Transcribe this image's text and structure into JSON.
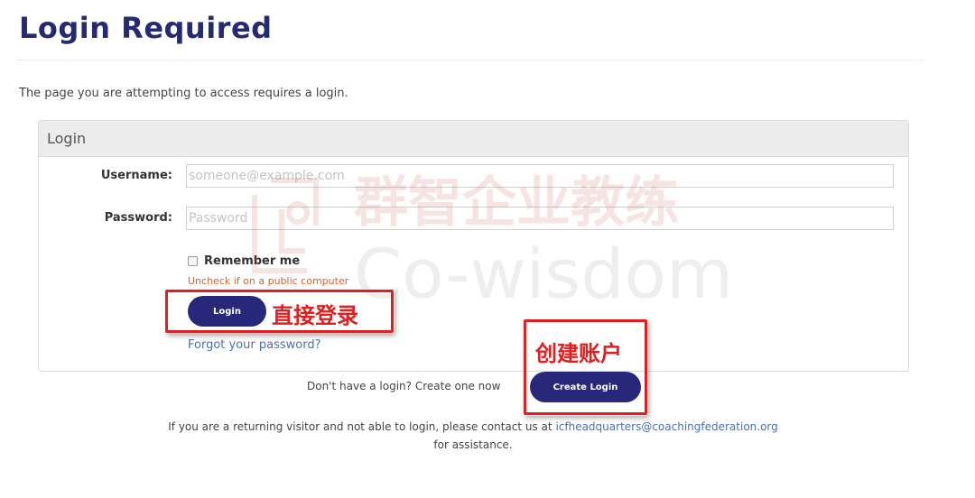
{
  "page": {
    "title": "Login Required",
    "intro": "The page you are attempting to access requires a login."
  },
  "login_panel": {
    "heading": "Login",
    "username_label": "Username:",
    "username_placeholder": "someone@example.com",
    "username_value": "",
    "password_label": "Password:",
    "password_placeholder": "Password",
    "password_value": "",
    "remember_label": "Remember me",
    "remember_checked": false,
    "remember_hint": "Uncheck if on a public computer",
    "login_button": "Login",
    "forgot_link": "Forgot your password?"
  },
  "create": {
    "prompt": "Don't have a login?  Create one now",
    "button": "Create Login"
  },
  "footer": {
    "line1_prefix": "If you are a returning visitor and not able to login, please contact us at ",
    "email": "icfheadquarters@coachingfederation.org",
    "line2": "for assistance."
  },
  "annotations": {
    "login_callout": "直接登录",
    "create_callout": "创建账户",
    "color": "#e02020"
  },
  "watermark": {
    "chinese": "群智企业教练",
    "latin": "Co-wisdom"
  },
  "colors": {
    "brand": "#252a72",
    "button": "#28287a",
    "link": "#4c6fb0",
    "hint": "#d9622b"
  }
}
